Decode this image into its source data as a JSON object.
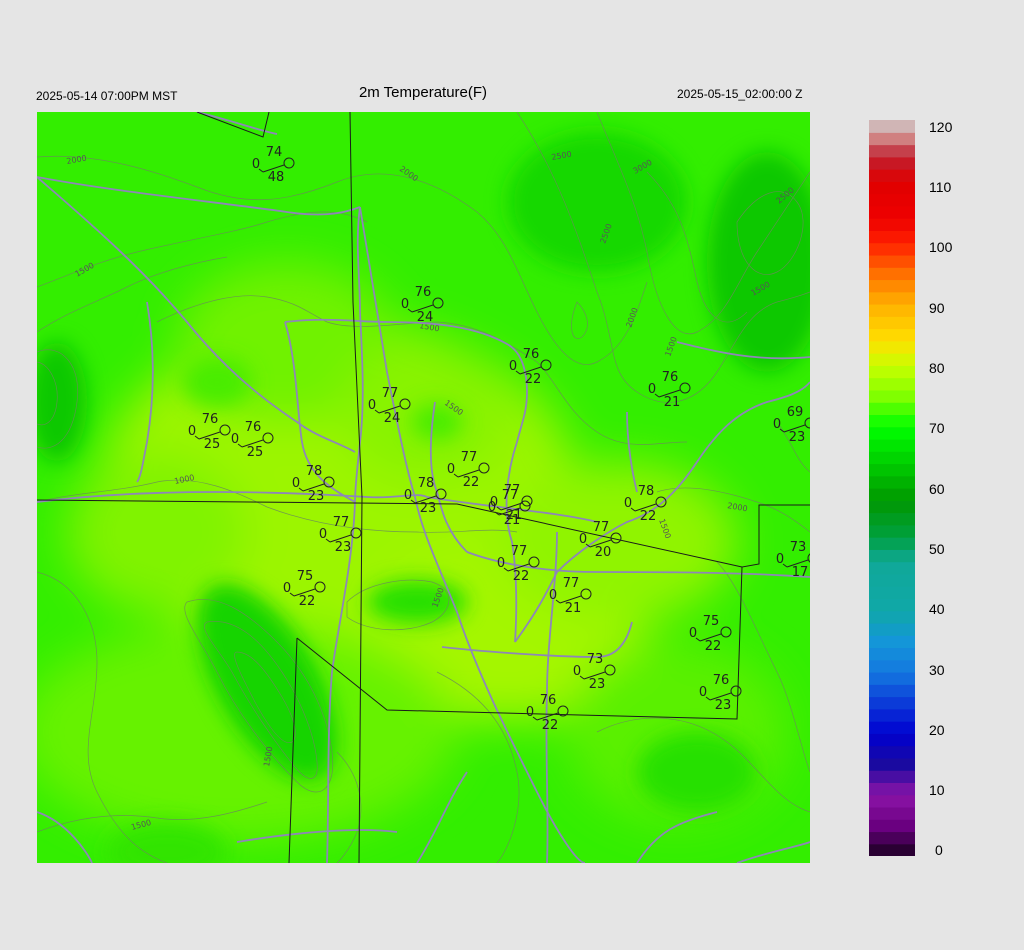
{
  "header": {
    "title": "2m Temperature(F)",
    "local_time": "2025-05-14 07:00PM MST",
    "valid_time": "2025-05-15_02:00:00 Z"
  },
  "colorbar": {
    "ticks": [
      "120",
      "110",
      "100",
      "90",
      "80",
      "70",
      "60",
      "50",
      "40",
      "30",
      "20",
      "10",
      "0"
    ],
    "stops": [
      {
        "v": 0,
        "c": "#1a0020"
      },
      {
        "v": 5,
        "c": "#6a0080"
      },
      {
        "v": 10,
        "c": "#8c14a8"
      },
      {
        "v": 15,
        "c": "#1a0aa0"
      },
      {
        "v": 20,
        "c": "#0000d0"
      },
      {
        "v": 25,
        "c": "#0b3bd8"
      },
      {
        "v": 30,
        "c": "#1478e0"
      },
      {
        "v": 35,
        "c": "#1496d8"
      },
      {
        "v": 40,
        "c": "#10a8a8"
      },
      {
        "v": 48,
        "c": "#10a898"
      },
      {
        "v": 52,
        "c": "#00a040"
      },
      {
        "v": 58,
        "c": "#009800"
      },
      {
        "v": 63,
        "c": "#00c400"
      },
      {
        "v": 70,
        "c": "#00ff00"
      },
      {
        "v": 75,
        "c": "#80ff00"
      },
      {
        "v": 80,
        "c": "#c8ff00"
      },
      {
        "v": 84,
        "c": "#ffe000"
      },
      {
        "v": 90,
        "c": "#ffb000"
      },
      {
        "v": 95,
        "c": "#ff7000"
      },
      {
        "v": 100,
        "c": "#ff2000"
      },
      {
        "v": 104,
        "c": "#ee0000"
      },
      {
        "v": 110,
        "c": "#e00000"
      },
      {
        "v": 114,
        "c": "#c02030"
      },
      {
        "v": 117,
        "c": "#d08080"
      },
      {
        "v": 120,
        "c": "#d0d0d0"
      }
    ]
  },
  "contour_labels": [
    "2000",
    "2000",
    "2500",
    "3000",
    "2500",
    "2500",
    "2000",
    "1500",
    "1500",
    "1500",
    "1500",
    "1500",
    "1000",
    "2000",
    "1500",
    "1500",
    "1500",
    "1500"
  ],
  "stations": [
    {
      "t": "74",
      "d": "48",
      "w": "0"
    },
    {
      "t": "76",
      "d": "24",
      "w": "0"
    },
    {
      "t": "76",
      "d": "22",
      "w": "0"
    },
    {
      "t": "76",
      "d": "21",
      "w": "0"
    },
    {
      "t": "77",
      "d": "24",
      "w": "0"
    },
    {
      "t": "76",
      "d": "25",
      "w": "0"
    },
    {
      "t": "76",
      "d": "25",
      "w": "0"
    },
    {
      "t": "69",
      "d": "23",
      "w": "0"
    },
    {
      "t": "77",
      "d": "22",
      "w": "0"
    },
    {
      "t": "78",
      "d": "23",
      "w": "0"
    },
    {
      "t": "78",
      "d": "23",
      "w": "0"
    },
    {
      "t": "77",
      "d": "21",
      "w": "0"
    },
    {
      "t": "77",
      "d": "21",
      "w": "0"
    },
    {
      "t": "78",
      "d": "22",
      "w": "0"
    },
    {
      "t": "77",
      "d": "23",
      "w": "0"
    },
    {
      "t": "77",
      "d": "20",
      "w": "0"
    },
    {
      "t": "73",
      "d": "17",
      "w": "0"
    },
    {
      "t": "77",
      "d": "22",
      "w": "0"
    },
    {
      "t": "75",
      "d": "22",
      "w": "0"
    },
    {
      "t": "77",
      "d": "21",
      "w": "0"
    },
    {
      "t": "75",
      "d": "22",
      "w": "0"
    },
    {
      "t": "73",
      "d": "23",
      "w": "0"
    },
    {
      "t": "76",
      "d": "23",
      "w": "0"
    },
    {
      "t": "76",
      "d": "22",
      "w": "0"
    }
  ]
}
